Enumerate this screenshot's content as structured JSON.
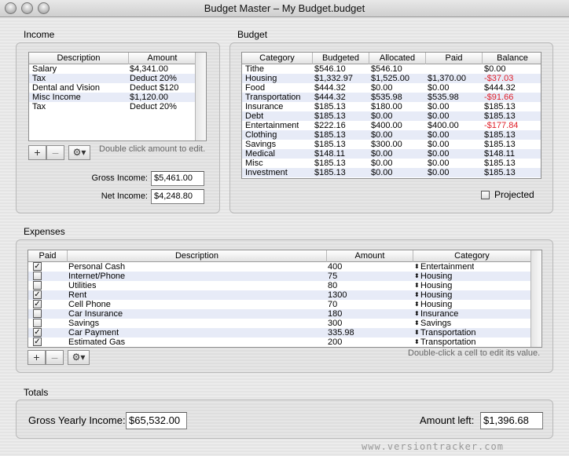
{
  "window": {
    "title": "Budget Master – My Budget.budget"
  },
  "income": {
    "section_label": "Income",
    "columns": [
      "Description",
      "Amount"
    ],
    "rows": [
      [
        "Salary",
        "$4,341.00"
      ],
      [
        "Tax",
        "Deduct 20%"
      ],
      [
        "Dental and Vision",
        "Deduct $120"
      ],
      [
        "Misc Income",
        "$1,120.00"
      ],
      [
        "Tax",
        "Deduct 20%"
      ]
    ],
    "add_label": "+",
    "remove_label": "–",
    "action_label": "⚙▾",
    "hint": "Double click amount to edit.",
    "gross_label": "Gross Income:",
    "gross_value": "$5,461.00",
    "net_label": "Net Income:",
    "net_value": "$4,248.80"
  },
  "budget": {
    "section_label": "Budget",
    "columns": [
      "Category",
      "Budgeted",
      "Allocated",
      "Paid",
      "Balance"
    ],
    "rows": [
      [
        "Tithe",
        "$546.10",
        "$546.10",
        "",
        "$0.00"
      ],
      [
        "Housing",
        "$1,332.97",
        "$1,525.00",
        "$1,370.00",
        "-$37.03"
      ],
      [
        "Food",
        "$444.32",
        "$0.00",
        "$0.00",
        "$444.32"
      ],
      [
        "Transportation",
        "$444.32",
        "$535.98",
        "$535.98",
        "-$91.66"
      ],
      [
        "Insurance",
        "$185.13",
        "$180.00",
        "$0.00",
        "$185.13"
      ],
      [
        "Debt",
        "$185.13",
        "$0.00",
        "$0.00",
        "$185.13"
      ],
      [
        "Entertainment",
        "$222.16",
        "$400.00",
        "$400.00",
        "-$177.84"
      ],
      [
        "Clothing",
        "$185.13",
        "$0.00",
        "$0.00",
        "$185.13"
      ],
      [
        "Savings",
        "$185.13",
        "$300.00",
        "$0.00",
        "$185.13"
      ],
      [
        "Medical",
        "$148.11",
        "$0.00",
        "$0.00",
        "$148.11"
      ],
      [
        "Misc",
        "$185.13",
        "$0.00",
        "$0.00",
        "$185.13"
      ],
      [
        "Investment",
        "$185.13",
        "$0.00",
        "$0.00",
        "$185.13"
      ]
    ],
    "negative_color": "#e0202a",
    "projected_label": "Projected",
    "projected_checked": false
  },
  "expenses": {
    "section_label": "Expenses",
    "columns": [
      "Paid",
      "Description",
      "Amount",
      "Category"
    ],
    "rows": [
      [
        true,
        "Personal Cash",
        "400",
        "Entertainment"
      ],
      [
        false,
        "Internet/Phone",
        "75",
        "Housing"
      ],
      [
        false,
        "Utilities",
        "80",
        "Housing"
      ],
      [
        true,
        "Rent",
        "1300",
        "Housing"
      ],
      [
        true,
        "Cell Phone",
        "70",
        "Housing"
      ],
      [
        false,
        "Car Insurance",
        "180",
        "Insurance"
      ],
      [
        false,
        "Savings",
        "300",
        "Savings"
      ],
      [
        true,
        "Car Payment",
        "335.98",
        "Transportation"
      ],
      [
        true,
        "Estimated Gas",
        "200",
        "Transportation"
      ]
    ],
    "add_label": "+",
    "remove_label": "–",
    "action_label": "⚙▾",
    "hint": "Double-click a cell to edit its value.",
    "updown_glyph": "⬍",
    "check_glyph": "✓"
  },
  "totals": {
    "section_label": "Totals",
    "gross_yearly_label": "Gross Yearly Income:",
    "gross_yearly_value": "$65,532.00",
    "amount_left_label": "Amount left:",
    "amount_left_value": "$1,396.68"
  },
  "watermark": "www.versiontracker.com"
}
